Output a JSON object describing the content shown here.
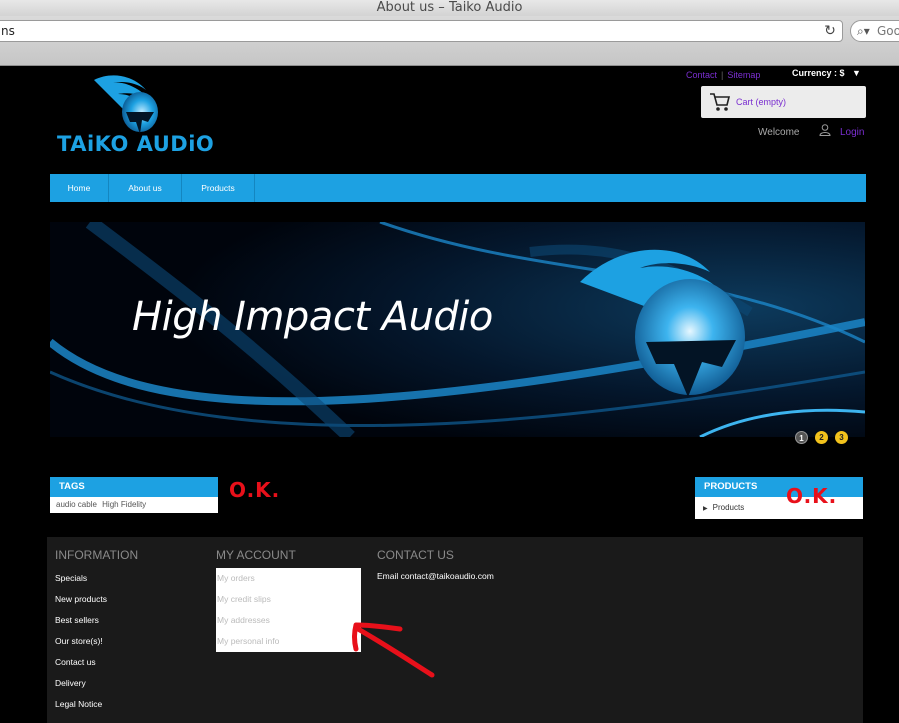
{
  "browser": {
    "window_title": "About us – Taiko Audio",
    "url_fragment": "ns",
    "search_placeholder": "Goo"
  },
  "header": {
    "logo_text": "TAiKO AUDiO",
    "contact_label": "Contact",
    "sitemap_label": "Sitemap",
    "currency_label": "Currency : $",
    "cart_label": "Cart (empty)",
    "welcome_label": "Welcome",
    "login_label": "Login"
  },
  "nav": {
    "items": [
      {
        "label": "Home"
      },
      {
        "label": "About us"
      },
      {
        "label": "Products"
      }
    ]
  },
  "banner": {
    "title": "High Impact Audio",
    "slides": [
      "1",
      "2",
      "3"
    ],
    "active_slide": 1
  },
  "tags_block": {
    "title": "TAGS",
    "tags": [
      "audio cable",
      "High Fidelity"
    ]
  },
  "products_block": {
    "title": "PRODUCTS",
    "items": [
      "Products"
    ]
  },
  "annotations": {
    "ok_left": "O.K.",
    "ok_right": "O.K."
  },
  "footer": {
    "information": {
      "title": "INFORMATION",
      "links": [
        "Specials",
        "New products",
        "Best sellers",
        "Our store(s)!",
        "Contact us",
        "Delivery",
        "Legal Notice"
      ]
    },
    "my_account": {
      "title": "MY ACCOUNT",
      "links": [
        "My orders",
        "My credit slips",
        "My addresses",
        "My personal info"
      ]
    },
    "contact_us": {
      "title": "CONTACT US",
      "email_line": "Email contact@taikoaudio.com"
    }
  },
  "colors": {
    "accent": "#1da1e2",
    "link_purple": "#7a2ed0",
    "annotation_red": "#e8101a",
    "footer_bg": "#1a1a1a"
  }
}
